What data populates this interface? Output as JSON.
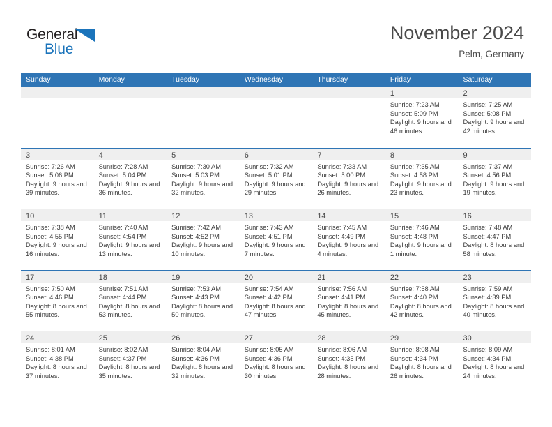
{
  "brand": {
    "name_part1": "General",
    "name_part2": "Blue",
    "accent_color": "#1b74bb",
    "triangle_icon": "brand-triangle-icon"
  },
  "header": {
    "title": "November 2024",
    "location": "Pelm, Germany"
  },
  "theme": {
    "header_blue": "#2f75b5",
    "day_band_gray": "#efefef",
    "text_color": "#3a3a3a"
  },
  "calendar": {
    "weekday_headers": [
      "Sunday",
      "Monday",
      "Tuesday",
      "Wednesday",
      "Thursday",
      "Friday",
      "Saturday"
    ],
    "weeks": [
      [
        {
          "day": "",
          "empty": true
        },
        {
          "day": "",
          "empty": true
        },
        {
          "day": "",
          "empty": true
        },
        {
          "day": "",
          "empty": true
        },
        {
          "day": "",
          "empty": true
        },
        {
          "day": "1",
          "sunrise": "Sunrise: 7:23 AM",
          "sunset": "Sunset: 5:09 PM",
          "daylight": "Daylight: 9 hours and 46 minutes."
        },
        {
          "day": "2",
          "sunrise": "Sunrise: 7:25 AM",
          "sunset": "Sunset: 5:08 PM",
          "daylight": "Daylight: 9 hours and 42 minutes."
        }
      ],
      [
        {
          "day": "3",
          "sunrise": "Sunrise: 7:26 AM",
          "sunset": "Sunset: 5:06 PM",
          "daylight": "Daylight: 9 hours and 39 minutes."
        },
        {
          "day": "4",
          "sunrise": "Sunrise: 7:28 AM",
          "sunset": "Sunset: 5:04 PM",
          "daylight": "Daylight: 9 hours and 36 minutes."
        },
        {
          "day": "5",
          "sunrise": "Sunrise: 7:30 AM",
          "sunset": "Sunset: 5:03 PM",
          "daylight": "Daylight: 9 hours and 32 minutes."
        },
        {
          "day": "6",
          "sunrise": "Sunrise: 7:32 AM",
          "sunset": "Sunset: 5:01 PM",
          "daylight": "Daylight: 9 hours and 29 minutes."
        },
        {
          "day": "7",
          "sunrise": "Sunrise: 7:33 AM",
          "sunset": "Sunset: 5:00 PM",
          "daylight": "Daylight: 9 hours and 26 minutes."
        },
        {
          "day": "8",
          "sunrise": "Sunrise: 7:35 AM",
          "sunset": "Sunset: 4:58 PM",
          "daylight": "Daylight: 9 hours and 23 minutes."
        },
        {
          "day": "9",
          "sunrise": "Sunrise: 7:37 AM",
          "sunset": "Sunset: 4:56 PM",
          "daylight": "Daylight: 9 hours and 19 minutes."
        }
      ],
      [
        {
          "day": "10",
          "sunrise": "Sunrise: 7:38 AM",
          "sunset": "Sunset: 4:55 PM",
          "daylight": "Daylight: 9 hours and 16 minutes."
        },
        {
          "day": "11",
          "sunrise": "Sunrise: 7:40 AM",
          "sunset": "Sunset: 4:54 PM",
          "daylight": "Daylight: 9 hours and 13 minutes."
        },
        {
          "day": "12",
          "sunrise": "Sunrise: 7:42 AM",
          "sunset": "Sunset: 4:52 PM",
          "daylight": "Daylight: 9 hours and 10 minutes."
        },
        {
          "day": "13",
          "sunrise": "Sunrise: 7:43 AM",
          "sunset": "Sunset: 4:51 PM",
          "daylight": "Daylight: 9 hours and 7 minutes."
        },
        {
          "day": "14",
          "sunrise": "Sunrise: 7:45 AM",
          "sunset": "Sunset: 4:49 PM",
          "daylight": "Daylight: 9 hours and 4 minutes."
        },
        {
          "day": "15",
          "sunrise": "Sunrise: 7:46 AM",
          "sunset": "Sunset: 4:48 PM",
          "daylight": "Daylight: 9 hours and 1 minute."
        },
        {
          "day": "16",
          "sunrise": "Sunrise: 7:48 AM",
          "sunset": "Sunset: 4:47 PM",
          "daylight": "Daylight: 8 hours and 58 minutes."
        }
      ],
      [
        {
          "day": "17",
          "sunrise": "Sunrise: 7:50 AM",
          "sunset": "Sunset: 4:46 PM",
          "daylight": "Daylight: 8 hours and 55 minutes."
        },
        {
          "day": "18",
          "sunrise": "Sunrise: 7:51 AM",
          "sunset": "Sunset: 4:44 PM",
          "daylight": "Daylight: 8 hours and 53 minutes."
        },
        {
          "day": "19",
          "sunrise": "Sunrise: 7:53 AM",
          "sunset": "Sunset: 4:43 PM",
          "daylight": "Daylight: 8 hours and 50 minutes."
        },
        {
          "day": "20",
          "sunrise": "Sunrise: 7:54 AM",
          "sunset": "Sunset: 4:42 PM",
          "daylight": "Daylight: 8 hours and 47 minutes."
        },
        {
          "day": "21",
          "sunrise": "Sunrise: 7:56 AM",
          "sunset": "Sunset: 4:41 PM",
          "daylight": "Daylight: 8 hours and 45 minutes."
        },
        {
          "day": "22",
          "sunrise": "Sunrise: 7:58 AM",
          "sunset": "Sunset: 4:40 PM",
          "daylight": "Daylight: 8 hours and 42 minutes."
        },
        {
          "day": "23",
          "sunrise": "Sunrise: 7:59 AM",
          "sunset": "Sunset: 4:39 PM",
          "daylight": "Daylight: 8 hours and 40 minutes."
        }
      ],
      [
        {
          "day": "24",
          "sunrise": "Sunrise: 8:01 AM",
          "sunset": "Sunset: 4:38 PM",
          "daylight": "Daylight: 8 hours and 37 minutes."
        },
        {
          "day": "25",
          "sunrise": "Sunrise: 8:02 AM",
          "sunset": "Sunset: 4:37 PM",
          "daylight": "Daylight: 8 hours and 35 minutes."
        },
        {
          "day": "26",
          "sunrise": "Sunrise: 8:04 AM",
          "sunset": "Sunset: 4:36 PM",
          "daylight": "Daylight: 8 hours and 32 minutes."
        },
        {
          "day": "27",
          "sunrise": "Sunrise: 8:05 AM",
          "sunset": "Sunset: 4:36 PM",
          "daylight": "Daylight: 8 hours and 30 minutes."
        },
        {
          "day": "28",
          "sunrise": "Sunrise: 8:06 AM",
          "sunset": "Sunset: 4:35 PM",
          "daylight": "Daylight: 8 hours and 28 minutes."
        },
        {
          "day": "29",
          "sunrise": "Sunrise: 8:08 AM",
          "sunset": "Sunset: 4:34 PM",
          "daylight": "Daylight: 8 hours and 26 minutes."
        },
        {
          "day": "30",
          "sunrise": "Sunrise: 8:09 AM",
          "sunset": "Sunset: 4:34 PM",
          "daylight": "Daylight: 8 hours and 24 minutes."
        }
      ]
    ]
  }
}
